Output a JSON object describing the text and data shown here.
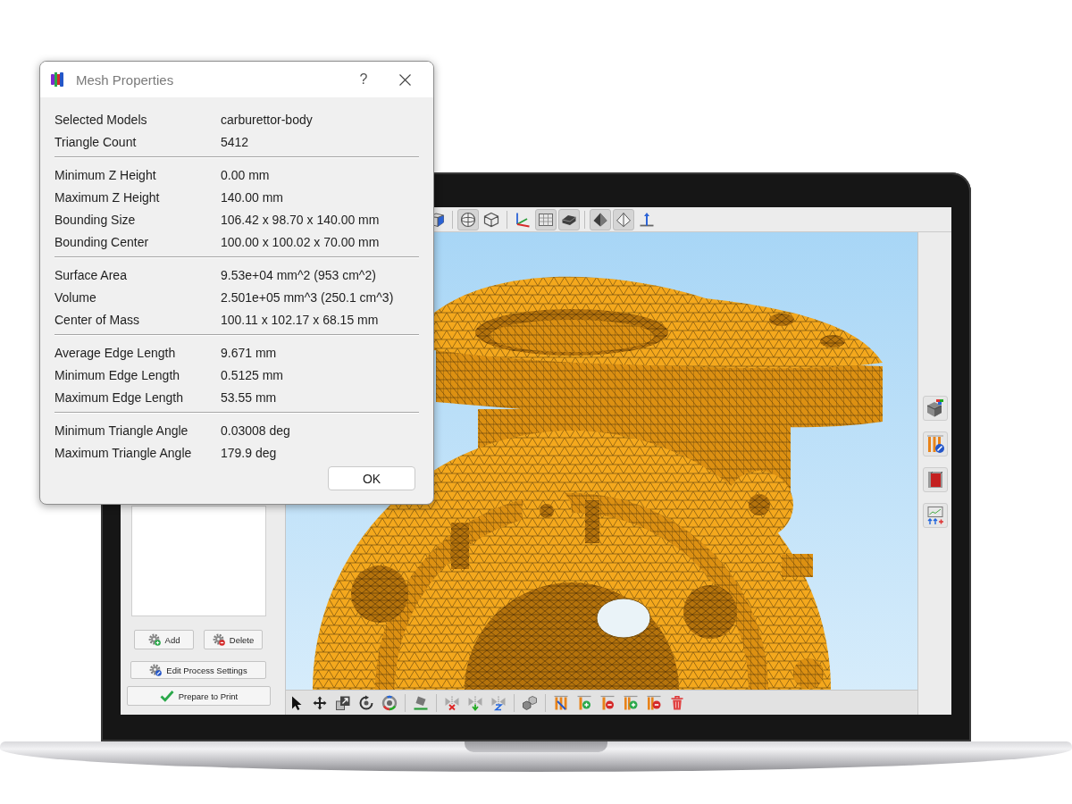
{
  "dialog": {
    "title": "Mesh Properties",
    "help_button": "?",
    "groups": [
      [
        {
          "label": "Selected Models",
          "value": "carburettor-body"
        },
        {
          "label": "Triangle Count",
          "value": "5412"
        }
      ],
      [
        {
          "label": "Minimum Z Height",
          "value": "0.00 mm"
        },
        {
          "label": "Maximum Z Height",
          "value": "140.00 mm"
        },
        {
          "label": "Bounding Size",
          "value": "106.42 x 98.70 x 140.00 mm"
        },
        {
          "label": "Bounding Center",
          "value": "100.00 x 100.02 x 70.00 mm"
        }
      ],
      [
        {
          "label": "Surface Area",
          "value": "9.53e+04 mm^2 (953 cm^2)"
        },
        {
          "label": "Volume",
          "value": "2.501e+05 mm^3 (250.1 cm^3)"
        },
        {
          "label": "Center of Mass",
          "value": "100.11 x 102.17 x 68.15 mm"
        }
      ],
      [
        {
          "label": "Average Edge Length",
          "value": "9.671 mm"
        },
        {
          "label": "Minimum Edge Length",
          "value": "0.5125 mm"
        },
        {
          "label": "Maximum Edge Length",
          "value": "53.55 mm"
        }
      ],
      [
        {
          "label": "Minimum Triangle Angle",
          "value": "0.03008 deg"
        },
        {
          "label": "Maximum Triangle Angle",
          "value": "179.9 deg"
        }
      ]
    ],
    "ok_button": "OK"
  },
  "view_toolbar": {
    "groups": [
      [
        {
          "selected": false
        }
      ],
      [
        {
          "selected": true
        },
        {
          "selected": false
        }
      ],
      [
        {
          "selected": false
        },
        {
          "selected": true
        },
        {
          "selected": true
        }
      ],
      [
        {
          "selected": true
        },
        {
          "selected": true
        },
        {
          "selected": false
        }
      ]
    ]
  },
  "process_panel": {
    "add_button": "Add",
    "delete_button": "Delete",
    "edit_button": "Edit Process Settings",
    "prepare_button": "Prepare to Print"
  }
}
